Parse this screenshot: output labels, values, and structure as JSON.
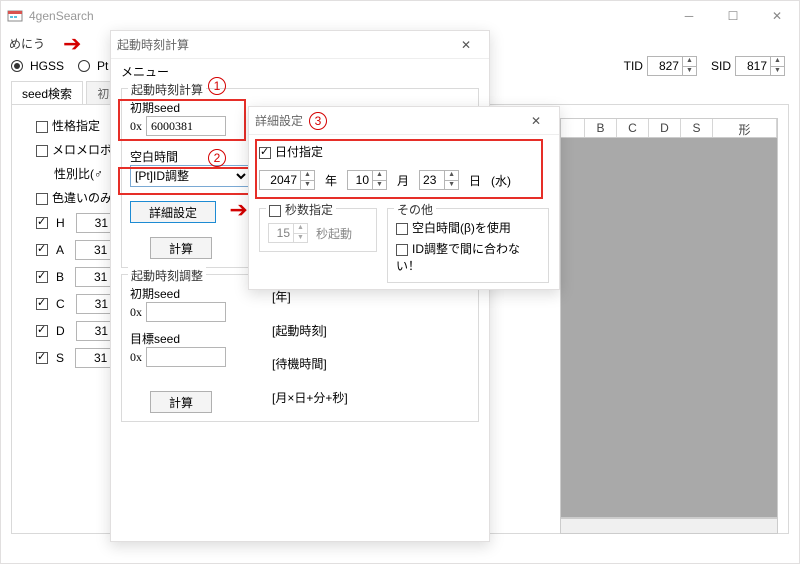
{
  "main": {
    "title": "4genSearch",
    "menu": "めにう",
    "radio_hgss": "HGSS",
    "radio_pt": "Pt",
    "tid_label": "TID",
    "tid_value": "827",
    "sid_label": "SID",
    "sid_value": "817",
    "tabs": {
      "seed": "seed検索",
      "shoki": "初期"
    }
  },
  "panel": {
    "seikaku": "性格指定",
    "meromero": "メロメロボデ",
    "seibetsu": "性別比(♂",
    "irochigai": "色違いのみ",
    "H": "H",
    "A": "A",
    "B": "B",
    "C": "C",
    "D": "D",
    "S": "S",
    "iv": "31"
  },
  "thead": {
    "B": "B",
    "C": "C",
    "D": "D",
    "S": "S",
    "kata": "形"
  },
  "dlg1": {
    "title": "起動時刻計算",
    "menu": "メニュー",
    "calc_label": "起動時刻計算",
    "seed_label": "初期seed",
    "hex": "0x",
    "seed_value": "6000381",
    "blank_label": "空白時間",
    "select_value": "[Pt]ID調整",
    "detail_btn": "詳細設定",
    "calc_btn": "計算",
    "adj_label": "起動時刻調整",
    "seed_label2": "初期seed",
    "target_label": "目標seed",
    "y": "[年]",
    "st": "[起動時刻]",
    "wt": "[待機時間]",
    "md": "[月×日+分+秒]"
  },
  "dlg2": {
    "title": "詳細設定",
    "date_chk": "日付指定",
    "year": "2047",
    "y": "年",
    "month": "10",
    "m": "月",
    "day": "23",
    "d": "日",
    "wd": "(水)",
    "sec_chk": "秒数指定",
    "sec_val": "15",
    "sec_run": "秒起動",
    "other": "その他",
    "beta": "空白時間(β)を使用",
    "idadj": "ID調整で間に合わない！"
  }
}
